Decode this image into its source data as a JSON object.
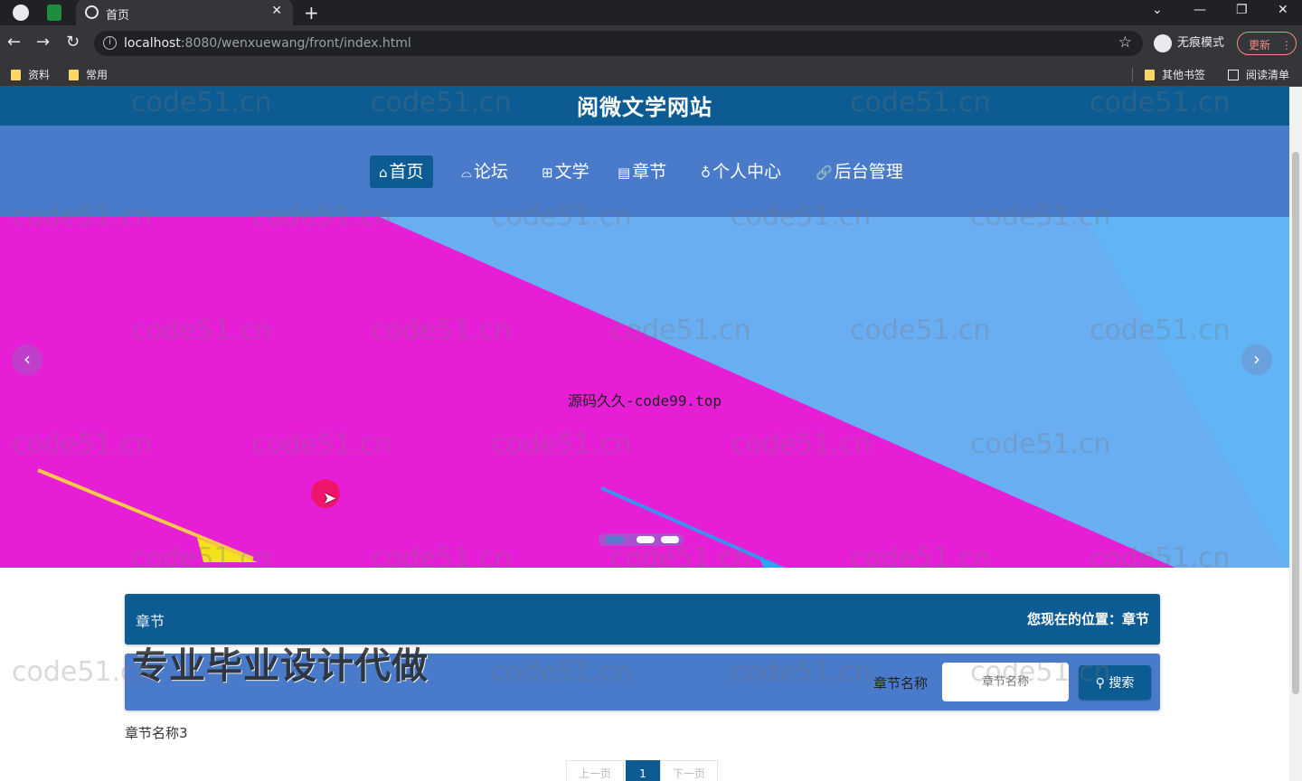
{
  "browser": {
    "tab_title": "首页",
    "url_host": "localhost",
    "url_path": ":8080/wenxuewang/front/index.html",
    "incognito_label": "无痕模式",
    "update_label": "更新",
    "bookmarks": [
      "资料",
      "常用"
    ],
    "bookmarks_right": [
      "其他书签",
      "阅读清单"
    ]
  },
  "site": {
    "title": "阅微文学网站",
    "nav": [
      {
        "icon": "⌂",
        "label": "首页"
      },
      {
        "icon": "⌓",
        "label": "论坛"
      },
      {
        "icon": "⊞",
        "label": "文学"
      },
      {
        "icon": "▤",
        "label": "章节"
      },
      {
        "icon": "♁",
        "label": "个人中心"
      },
      {
        "icon": "🔗",
        "label": "后台管理"
      }
    ],
    "banner_caption": "源码久久-code99.top",
    "carousel": {
      "slides": 3,
      "current": 1
    }
  },
  "section": {
    "title": "章节",
    "location": "您现在的位置：章节",
    "search_label": "章节名称",
    "search_placeholder": "章节名称",
    "search_button": "搜索",
    "promo_overlay": "专业毕业设计代做",
    "results": [
      "章节名称3"
    ],
    "pager": {
      "prev": "上一页",
      "current": "1",
      "next": "下一页"
    }
  },
  "watermark_text": "code51.cn",
  "colors": {
    "primary": "#0c5b92",
    "nav_bg": "#4a7bca",
    "banner_pink": "#e61fd6",
    "banner_blue": "#6aaef2"
  }
}
